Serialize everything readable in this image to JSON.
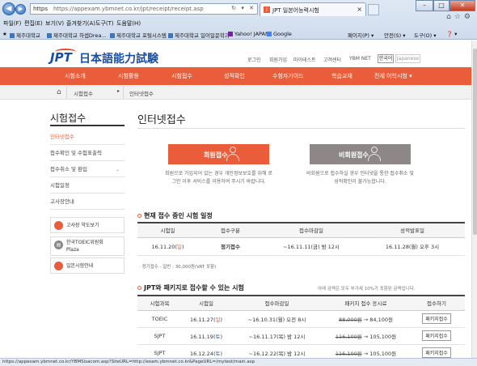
{
  "browser": {
    "address_protocol": "https",
    "address_url": "https://appexam.ybmnet.co.kr/jpt/receipt/receipt.asp",
    "address_controls": "↻ ▾ ✕",
    "tab_title": "JPT 일본어능력시험",
    "menu": [
      "파일(F)",
      "편집(E)",
      "보기(V)",
      "즐겨찾기(A)",
      "도구(T)",
      "도움말(H)"
    ],
    "favorites": [
      "제주대학교",
      "제주대학교 하셉Drea...",
      "제주대학교 포털시스템",
      "제주대학교 일어일문학과",
      "Yahoo! JAPAN",
      "Google"
    ],
    "commands": [
      "페이지(P) ▾",
      "안전(S) ▾",
      "도구(O) ▾",
      "❓ ▾"
    ],
    "status_url": "https://appexam.ybmnet.co.kr/YBMSisacom.asp?SiteURL=http://exam.ybmnet.co.kr&PageURL=/mytest/main.asp"
  },
  "site": {
    "logo_jpt": "JPT",
    "logo_kanji": "日本語能力試験",
    "util_nav": [
      "로그인",
      "회원가입",
      "마이테스트",
      "고객센터",
      "YBM NET"
    ],
    "lang_ko": "한국어",
    "lang_ja": "Japanese",
    "gnb": [
      "시험소개",
      "시험활용",
      "시험접수",
      "성적확인",
      "수험자가이드",
      "학습교재",
      "전체 어학시험 ▾"
    ]
  },
  "breadcrumb": {
    "level1": "시험접수",
    "level2": "인터넷접수"
  },
  "sidebar": {
    "title": "시험접수",
    "items": [
      {
        "label": "인터넷접수"
      },
      {
        "label": "접수확인 및 수험표출력"
      },
      {
        "label": "접수취소 및 환입"
      },
      {
        "label": "시험일정"
      },
      {
        "label": "고사장안내"
      }
    ],
    "boxes": [
      {
        "line1": "고사장 약도보기",
        "line2": ""
      },
      {
        "line1": "한국TOEIC위원회",
        "line2": "Plaza"
      },
      {
        "line1": "일본시험안내",
        "line2": ""
      }
    ]
  },
  "main": {
    "title": "인터넷접수",
    "member_button": "회원접수",
    "guest_button": "비회원접수",
    "member_desc": "회원으로 가입되어 있는 경우 개인정보보호를 위해 로그인 이후 서비스를 이용하여 주시기 바랍니다.",
    "guest_desc": "비회원으로 접수하실 경우 인터넷을 통한 접수취소 및 성적확인이 불가능합니다.",
    "section1_title": "현재 접수 중인 시험 일정",
    "table1": {
      "headers": [
        "시험일",
        "접수구분",
        "접수마감일",
        "성적발표일"
      ],
      "row": {
        "date": "16.11.20",
        "day": "일",
        "type": "정기접수",
        "deadline": "~16.11.11(금) 밤 12시",
        "result": "16.11.28(월) 오후 3시"
      }
    },
    "fee_note": "· 정기접수 - 일반 : 30,000원(VAT 포함)",
    "section2_title": "JPT와 패키지로 접수할 수 있는 시험",
    "section2_note": "아래 금액은 모두 부가세 10%가 포함된 금액입니다.",
    "table2": {
      "headers": [
        "시험과목",
        "시험일",
        "접수마감일",
        "패키지 접수 응시료",
        "접수하기"
      ],
      "rows": [
        {
          "subject": "TOEIC",
          "date": "16.11.27",
          "day": "일",
          "day_color": "red",
          "deadline": "~16.10.31(월) 오전 8시",
          "old_fee": "88,000원",
          "new_fee": "→ 84,100원",
          "button": "패키지접수"
        },
        {
          "subject": "SJPT",
          "date": "16.11.19",
          "day": "토",
          "day_color": "blue",
          "deadline": "~16.11.17(목) 밤 12시",
          "old_fee": "116,100원",
          "new_fee": "→ 105,100원",
          "button": "패키지접수"
        },
        {
          "subject": "SJPT",
          "date": "16.12.24",
          "day": "토",
          "day_color": "blue",
          "deadline": "~16.12.22(목) 밤 12시",
          "old_fee": "116,100원",
          "new_fee": "→ 105,100원",
          "button": "패키지접수"
        }
      ]
    }
  },
  "colors": {
    "brand": "#ea5d3b",
    "guest_button": "#8d8887",
    "logo_blue": "#1a4ea2",
    "saturday_blue": "#2b5aa8"
  }
}
